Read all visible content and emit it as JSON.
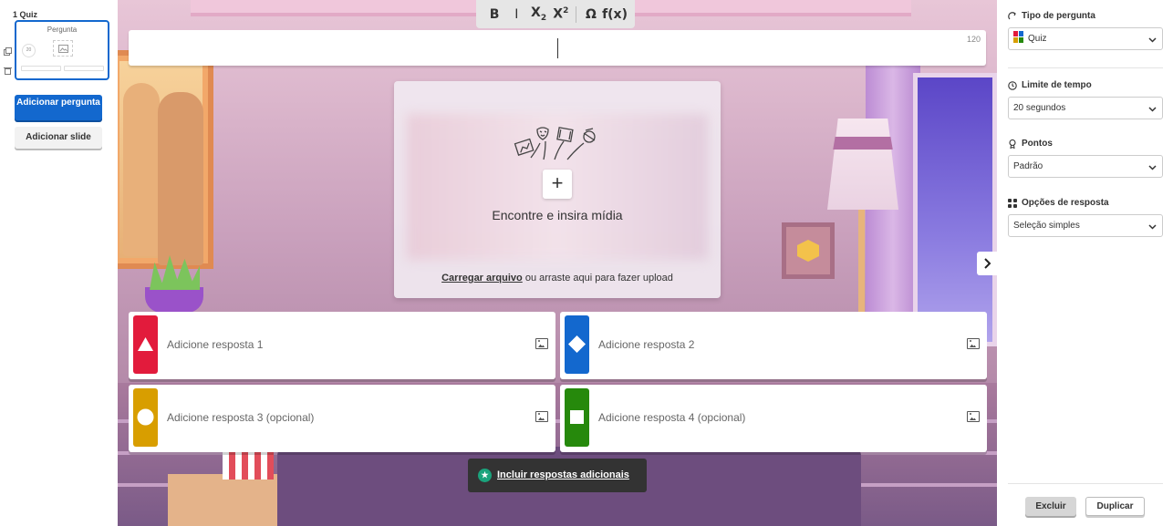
{
  "sidebar": {
    "slide_label": "1  Quiz",
    "thumb_title": "Pergunta",
    "thumb_timer": "20",
    "add_question": "Adicionar pergunta",
    "add_slide": "Adicionar slide"
  },
  "toolbar": {
    "bold": "B",
    "italic": "I",
    "subscript_base": "X",
    "subscript_mark": "2",
    "superscript_base": "X",
    "superscript_mark": "2",
    "omega": "Ω",
    "function": "f(x)"
  },
  "question": {
    "value": "",
    "char_count": "120"
  },
  "media": {
    "plus": "+",
    "title": "Encontre e insira mídia",
    "upload_link": "Carregar arquivo",
    "upload_rest": " ou arraste aqui para fazer upload"
  },
  "answers": [
    {
      "placeholder": "Adicione resposta 1",
      "color": "#e21b3c",
      "shape": "triangle"
    },
    {
      "placeholder": "Adicione resposta 2",
      "color": "#1368ce",
      "shape": "diamond"
    },
    {
      "placeholder": "Adicione resposta 3 (opcional)",
      "color": "#d89e00",
      "shape": "circle"
    },
    {
      "placeholder": "Adicione resposta 4 (opcional)",
      "color": "#26890c",
      "shape": "square"
    }
  ],
  "more_answers": "Incluir respostas adicionais",
  "settings": {
    "question_type": {
      "label": "Tipo de pergunta",
      "value": "Quiz"
    },
    "time_limit": {
      "label": "Limite de tempo",
      "value": "20 segundos"
    },
    "points": {
      "label": "Pontos",
      "value": "Padrão"
    },
    "answer_options": {
      "label": "Opções de resposta",
      "value": "Seleção simples"
    }
  },
  "footer": {
    "delete": "Excluir",
    "duplicate": "Duplicar"
  }
}
